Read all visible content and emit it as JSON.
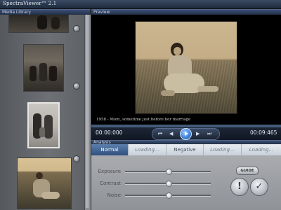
{
  "app": {
    "title": "SpectraViewer™ 2.1"
  },
  "panels": {
    "library_title": "Media Library",
    "preview_title": "Preview",
    "analysis_title": "Analysis"
  },
  "preview": {
    "caption": "1958 - Mom, sometime just before her marriage",
    "playback_progress": 0.0
  },
  "transport": {
    "current_time": "00:00:000",
    "total_time": "00:09:465",
    "buttons": [
      {
        "icon": "skip-back-icon",
        "glyph": "⏮"
      },
      {
        "icon": "rewind-icon",
        "glyph": "◀"
      },
      {
        "icon": "play-icon",
        "glyph": ""
      },
      {
        "icon": "forward-icon",
        "glyph": "▶"
      },
      {
        "icon": "skip-forward-icon",
        "glyph": "⏭"
      }
    ]
  },
  "analysis": {
    "tabs": [
      {
        "label": "Normal",
        "state": "active"
      },
      {
        "label": "Loading...",
        "state": "loading"
      },
      {
        "label": "Negative",
        "state": "normal"
      },
      {
        "label": "Loading...",
        "state": "loading"
      },
      {
        "label": "Loading...",
        "state": "loading"
      }
    ],
    "sliders": [
      {
        "label": "Exposure",
        "value": 0.5
      },
      {
        "label": "Contrast",
        "value": 0.5
      },
      {
        "label": "Noise",
        "value": 0.5
      }
    ],
    "guide_label": "GUIDE",
    "alert_label": "!",
    "confirm_label": "✓"
  },
  "colors": {
    "accent": "#3d7fd4",
    "active_tab": "#2f4f7e"
  }
}
